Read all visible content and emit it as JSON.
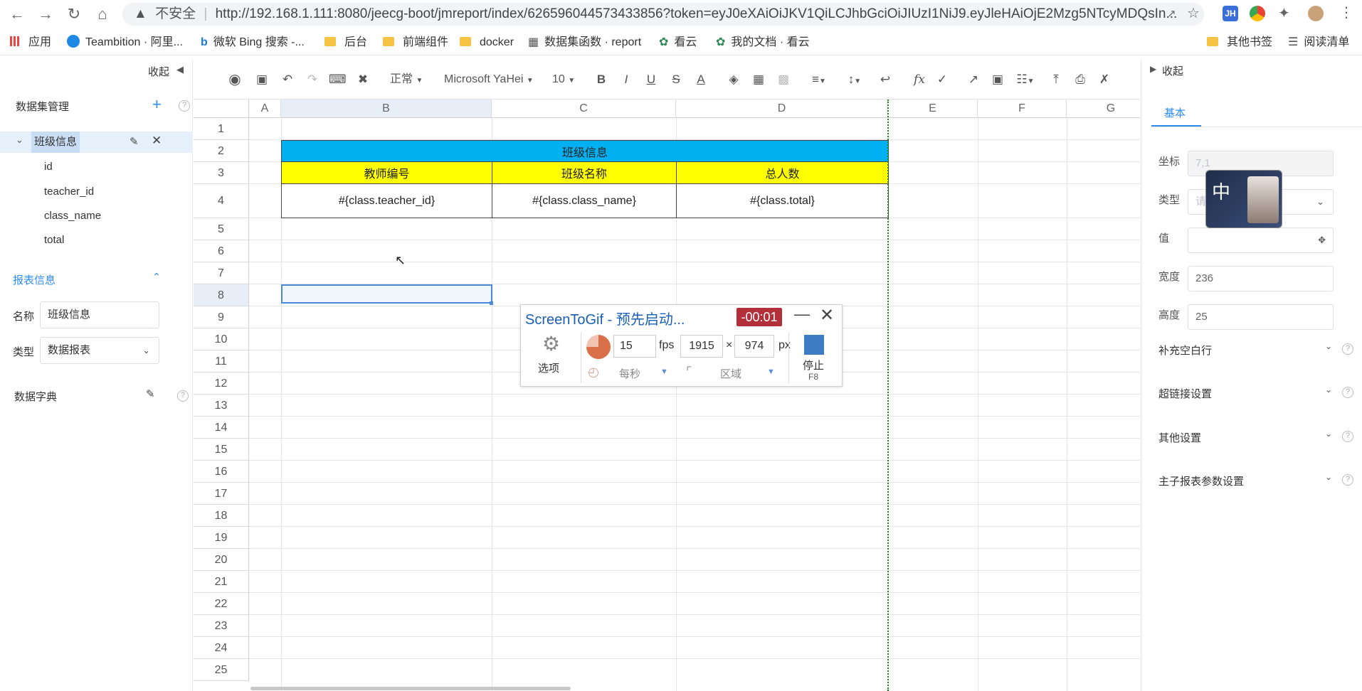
{
  "browser": {
    "security": "不安全",
    "url": "http://192.168.1.111:8080/jeecg-boot/jmreport/index/626596044573433856?token=eyJ0eXAiOiJKV1QiLCJhbGciOiJIUzI1NiJ9.eyJleHAiOjE2Mzg5NTcyMDQsIn...",
    "bookmarks": [
      "应用",
      "Teambition · 阿里...",
      "微软 Bing 搜索 -...",
      "后台",
      "前端组件",
      "docker",
      "数据集函数 · report",
      "看云",
      "我的文档 · 看云"
    ],
    "right_bookmarks": [
      "其他书签",
      "阅读清单"
    ],
    "ext_badge": "JH"
  },
  "left_panel": {
    "collapse_label": "收起",
    "dataset_title": "数据集管理",
    "dataset_name": "班级信息",
    "fields": [
      "id",
      "teacher_id",
      "class_name",
      "total"
    ],
    "report_info_title": "报表信息",
    "name_label": "名称",
    "name_value": "班级信息",
    "type_label": "类型",
    "type_value": "数据报表",
    "dict_title": "数据字典"
  },
  "toolbar": {
    "format": "正常",
    "font": "Microsoft YaHei",
    "size": "10"
  },
  "sheet": {
    "columns": [
      "A",
      "B",
      "C",
      "D",
      "E",
      "F",
      "G"
    ],
    "rows": [
      "1",
      "2",
      "3",
      "4",
      "5",
      "6",
      "7",
      "8",
      "9",
      "10",
      "11",
      "12",
      "13",
      "14",
      "15",
      "16",
      "17",
      "18",
      "19",
      "20",
      "21",
      "22",
      "23",
      "24",
      "25"
    ],
    "title": "班级信息",
    "headers": [
      "教师编号",
      "班级名称",
      "总人数"
    ],
    "values": [
      "#{class.teacher_id}",
      "#{class.class_name}",
      "#{class.total}"
    ],
    "title_color": "#00b0f0",
    "header_color": "#ffff00"
  },
  "right_panel": {
    "collapse_label": "收起",
    "tab": "基本",
    "coord_label": "坐标",
    "coord_value": "7,1",
    "type_label": "类型",
    "type_placeholder": "请",
    "value_label": "值",
    "width_label": "宽度",
    "width_value": "236",
    "height_label": "高度",
    "height_value": "25",
    "sections": [
      "补充空白行",
      "超链接设置",
      "其他设置",
      "主子报表参数设置"
    ],
    "ime_char": "中"
  },
  "screentogif": {
    "title": "ScreenToGif - 预先启动...",
    "timer": "-00:01",
    "options_label": "选项",
    "fps_value": "15",
    "fps_unit": "fps",
    "width_value": "1915",
    "times": "×",
    "height_value": "974",
    "px_unit": "px",
    "per_second": "每秒",
    "region": "区域",
    "stop_label": "停止",
    "stop_key": "F8"
  }
}
